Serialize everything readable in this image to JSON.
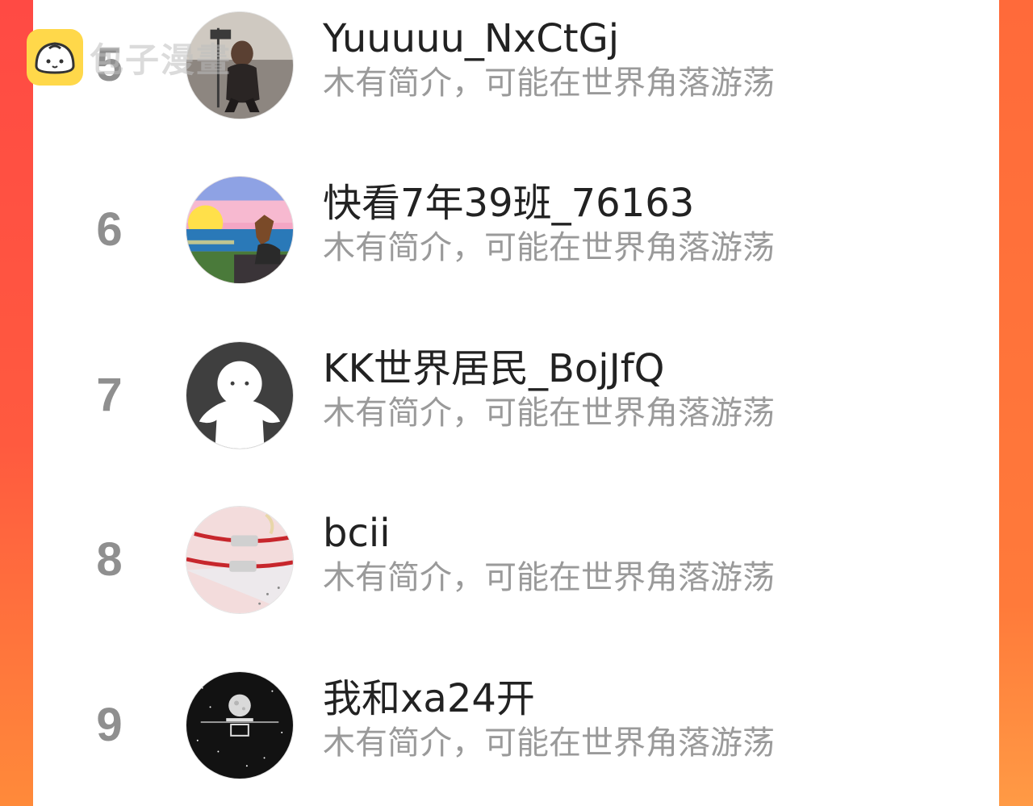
{
  "watermark": {
    "text": "包子漫畫",
    "icon": "bun-logo-icon"
  },
  "users": [
    {
      "rank": "5",
      "name": "Yuuuuu_NxCtGj",
      "bio": "木有简介，可能在世界角落游荡",
      "avatar": "avatar-photo-person"
    },
    {
      "rank": "6",
      "name": "快看7年39班_76163",
      "bio": "木有简介，可能在世界角落游荡",
      "avatar": "avatar-horse-sunset"
    },
    {
      "rank": "7",
      "name": "KK世界居民_BojJfQ",
      "bio": "木有简介，可能在世界角落游荡",
      "avatar": "avatar-default-ghost"
    },
    {
      "rank": "8",
      "name": "bcii",
      "bio": "木有简介，可能在世界角落游荡",
      "avatar": "avatar-red-bracelet"
    },
    {
      "rank": "9",
      "name": "我和xa24开",
      "bio": "木有简介，可能在世界角落游荡",
      "avatar": "avatar-moon-starry"
    }
  ],
  "colors": {
    "side_gradient_top": "#ff4a44",
    "side_gradient_bottom": "#ff8a3a",
    "rank_text": "#8f8f8f",
    "name_text": "#222222",
    "bio_text": "#9a9a9a"
  }
}
